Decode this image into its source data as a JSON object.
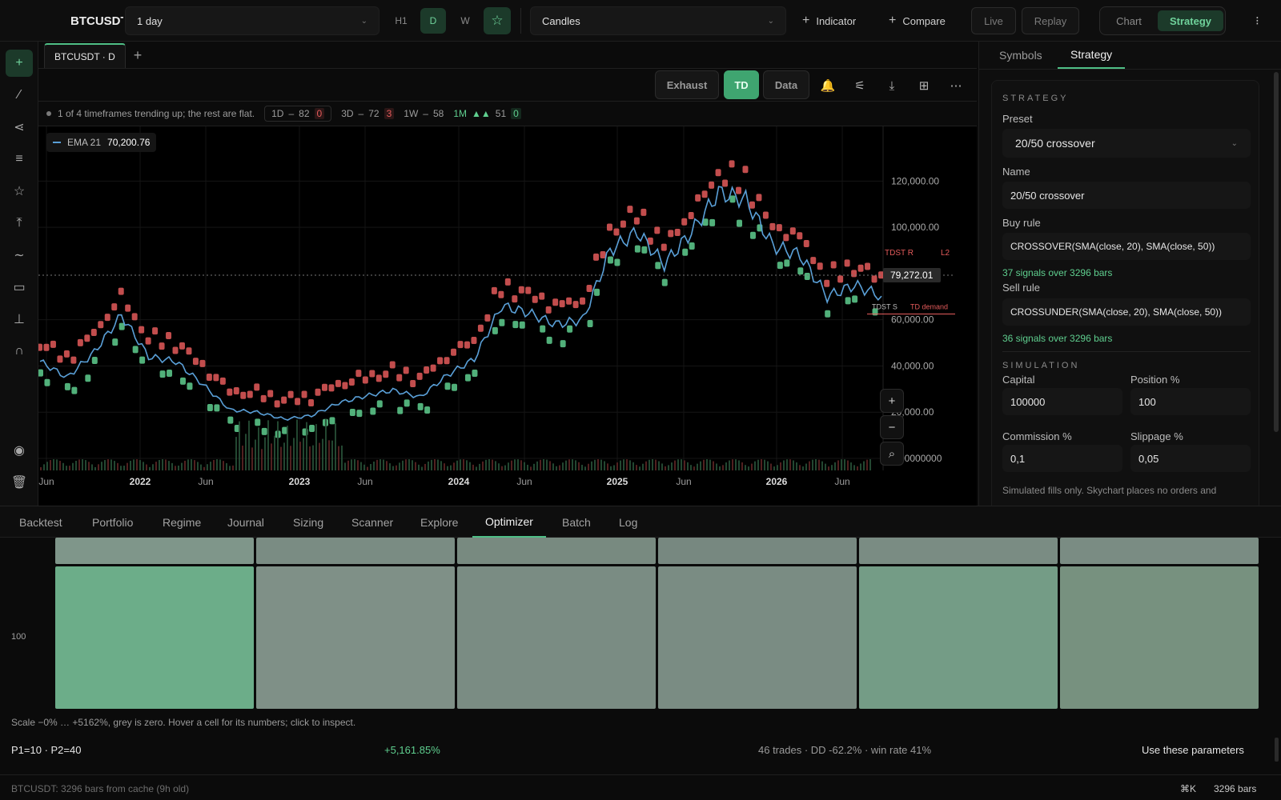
{
  "topbar": {
    "symbol": "BTCUSDT",
    "interval": "1 day",
    "timeframes": [
      "H1",
      "D",
      "W"
    ],
    "active_timeframe": "D",
    "chart_type": "Candles",
    "indicator_label": "Indicator",
    "compare_label": "Compare",
    "live_label": "Live",
    "replay_label": "Replay",
    "view_tabs": [
      "Chart",
      "Strategy"
    ],
    "active_view": "Strategy",
    "overflow": "⁝"
  },
  "chart_tab": {
    "label": "BTCUSDT · D",
    "add": "+"
  },
  "chart_toolbar": {
    "exhaust": "Exhaust",
    "td": "TD",
    "data": "Data"
  },
  "tf_info": {
    "summary": "1 of 4 timeframes trending up; the rest are flat.",
    "chips": [
      {
        "tf": "1D",
        "sep": "–",
        "value": "82",
        "count": "0",
        "count_color": "red"
      },
      {
        "tf": "3D",
        "sep": "–",
        "value": "72",
        "count": "3",
        "count_color": "red"
      },
      {
        "tf": "1W",
        "sep": "–",
        "value": "58",
        "count": "",
        "count_color": ""
      },
      {
        "tf": "1M",
        "sep": "▲▲",
        "value": "51",
        "count": "0",
        "count_color": "green"
      }
    ]
  },
  "legend": {
    "name": "EMA 21",
    "value": "70,200.76"
  },
  "chart_data": {
    "type": "line",
    "title": "",
    "xlabel": "",
    "ylabel": "",
    "y_ticks": [
      "120,000.00",
      "100,000.00",
      "60,000.00",
      "40,000.00",
      "20,000.00",
      "0.00000000"
    ],
    "x_ticks": [
      "Jun",
      "2022",
      "Jun",
      "2023",
      "Jun",
      "2024",
      "Jun",
      "2025",
      "Jun",
      "2026",
      "Jun"
    ],
    "ylim": [
      0,
      135000
    ],
    "last_price": "79,272.01",
    "markers": [
      "TDST R",
      "TDST S",
      "TD demand",
      "L2"
    ],
    "series": [
      {
        "name": "EMA 21",
        "x": [
          "2021-05",
          "2021-07",
          "2021-09",
          "2021-11",
          "2022-01",
          "2022-03",
          "2022-05",
          "2022-07",
          "2022-09",
          "2022-11",
          "2023-01",
          "2023-03",
          "2023-05",
          "2023-07",
          "2023-09",
          "2023-11",
          "2024-01",
          "2024-03",
          "2024-05",
          "2024-07",
          "2024-09",
          "2024-11",
          "2025-01",
          "2025-03",
          "2025-05",
          "2025-07",
          "2025-09",
          "2025-11",
          "2026-01",
          "2026-03",
          "2026-05",
          "2026-07"
        ],
        "values": [
          42000,
          35000,
          46000,
          62000,
          44000,
          42000,
          32000,
          21000,
          20000,
          17000,
          18500,
          24000,
          27000,
          29500,
          26500,
          36000,
          43000,
          66000,
          63000,
          58000,
          60000,
          90000,
          98000,
          84000,
          98000,
          115000,
          112000,
          92000,
          88000,
          70000,
          75000,
          70200
        ]
      }
    ]
  },
  "right_panel": {
    "tabs": [
      "Symbols",
      "Strategy"
    ],
    "active_tab": "Strategy",
    "strategy_header": "STRATEGY",
    "preset_label": "Preset",
    "preset_value": "20/50 crossover",
    "name_label": "Name",
    "name_value": "20/50 crossover",
    "buy_label": "Buy rule",
    "buy_rule": "CROSSOVER(SMA(close, 20), SMA(close, 50))",
    "buy_signals": "37 signals over 3296 bars",
    "sell_label": "Sell rule",
    "sell_rule": "CROSSUNDER(SMA(close, 20), SMA(close, 50))",
    "sell_signals": "36 signals over 3296 bars",
    "simulation_header": "SIMULATION",
    "capital_label": "Capital",
    "capital_value": "100000",
    "position_label": "Position %",
    "position_value": "100",
    "commission_label": "Commission %",
    "commission_value": "0,1",
    "slippage_label": "Slippage %",
    "slippage_value": "0,05",
    "note": "Simulated fills only. Skychart places no orders and"
  },
  "bottom_tabs": [
    "Backtest",
    "Portfolio",
    "Regime",
    "Journal",
    "Sizing",
    "Scanner",
    "Explore",
    "Optimizer",
    "Batch",
    "Log"
  ],
  "active_bottom_tab": "Optimizer",
  "optimizer": {
    "row_label": "100",
    "scale_note": "Scale −0% … +5162%, grey is zero. Hover a cell for its numbers; click to inspect.",
    "params": "P1=10 · P2=40",
    "return": "+5,161.85%",
    "stats": "46 trades · DD -62.2% · win rate 41%",
    "use_button": "Use these parameters",
    "top_row_colors": [
      "#7f968a",
      "#7a8c83",
      "#788a80",
      "#778880",
      "#7a8c83",
      "#7a8c83"
    ],
    "main_row_colors": [
      "#6cad89",
      "#7f9087",
      "#7a8c83",
      "#7a8c83",
      "#749c86",
      "#77917f"
    ]
  },
  "status": {
    "left": "BTCUSDT: 3296 bars from cache (9h old)",
    "shortcut": "⌘K",
    "bars": "3296 bars"
  },
  "colors": {
    "accent": "#4fbf86",
    "up": "#5fcf8f",
    "down": "#e45b5b",
    "ema": "#5aa0d8"
  }
}
